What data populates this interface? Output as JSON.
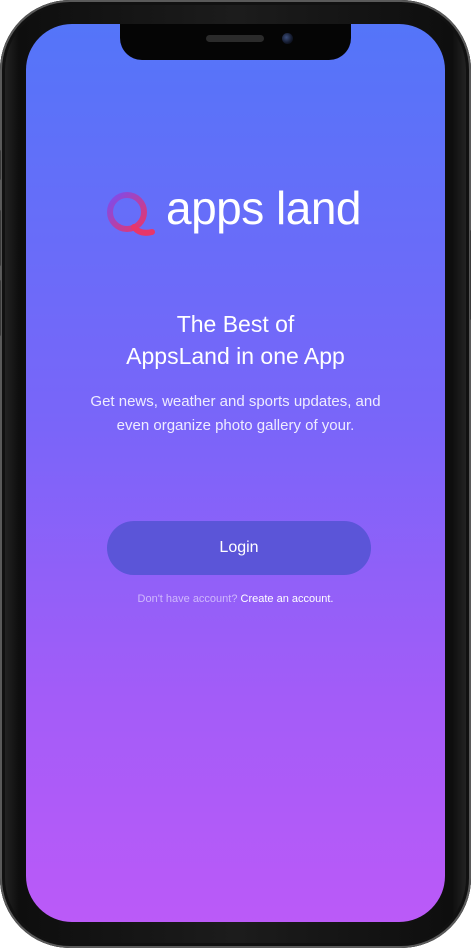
{
  "app": {
    "logo_icon": "q-ring-logo-icon",
    "logo_text": "apps land",
    "logo_gradient": [
      "#7b4cf0",
      "#e8366a"
    ]
  },
  "intro": {
    "headline_line1": "The Best of",
    "headline_line2": "AppsLand in one App",
    "description_line1": "Get news, weather and sports updates, and",
    "description_line2": "even organize photo gallery of your."
  },
  "actions": {
    "login_label": "Login",
    "signup_prompt": "Don't have account?",
    "signup_link": "Create an account."
  },
  "colors": {
    "gradient_top": "#5475f9",
    "gradient_bottom": "#bb5af8",
    "button": "#5b55d8"
  }
}
